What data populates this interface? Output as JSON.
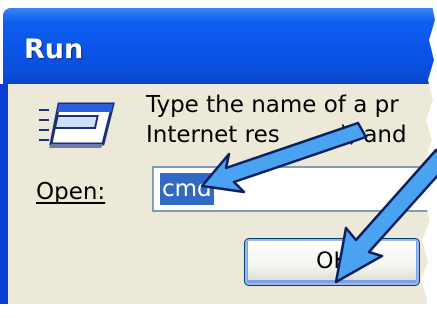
{
  "window": {
    "title": "Run"
  },
  "dialog": {
    "description_line1": "Type the name of a pr",
    "description_line2": "Internet res",
    "description_line2_tail": "), and",
    "open_label": "Open:",
    "open_label_accesskey": "O",
    "open_value": "cmd",
    "ok_label": "OK"
  },
  "icons": {
    "run": "run-program-icon",
    "annotation": "arrow-pointer-icon"
  },
  "colors": {
    "titlebar": "#0a55e8",
    "client_background": "#ece9d8",
    "selection": "#316ac5",
    "arrow_fill": "#4aa3f0"
  }
}
